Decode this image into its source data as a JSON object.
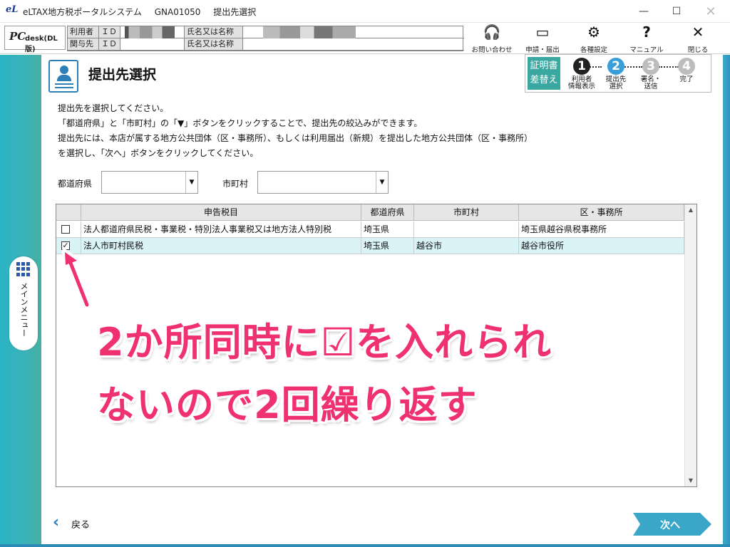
{
  "window": {
    "app_logo": "eL",
    "app_name": "eLTAX地方税ポータルシステム",
    "screen_id": "GNA01050",
    "screen_title": "提出先選択",
    "minimize_glyph": "—",
    "maximize_glyph": "☐",
    "close_glyph": "✕"
  },
  "header": {
    "brand_pc": "PC",
    "brand_desk": "desk(DL版)",
    "user_label": "利用者",
    "related_label": "関与先",
    "id_label": "ＩＤ",
    "name_label": "氏名又は名称",
    "tools": [
      {
        "label": "お問い合わせ",
        "icon": "headset-icon",
        "glyph": "🎧"
      },
      {
        "label": "申請・届出",
        "icon": "form-window-icon",
        "glyph": "▭"
      },
      {
        "label": "各種設定",
        "icon": "gear-icon",
        "glyph": "⚙"
      },
      {
        "label": "マニュアル",
        "icon": "question-icon",
        "glyph": "?"
      },
      {
        "label": "閉じる",
        "icon": "close-icon",
        "glyph": "✕"
      }
    ]
  },
  "sidebar": {
    "main_menu_label": "メインメニュー",
    "icon": "grid-icon"
  },
  "page": {
    "title": "提出先選択",
    "icon": "user-document-icon"
  },
  "steps": {
    "cert_button": [
      "証明書",
      "差替え"
    ],
    "items": [
      {
        "num": "1",
        "label": [
          "利用者",
          "情報表示"
        ],
        "state": "done"
      },
      {
        "num": "2",
        "label": [
          "提出先",
          "選択"
        ],
        "state": "current"
      },
      {
        "num": "3",
        "label": [
          "署名・",
          "送信"
        ],
        "state": "todo"
      },
      {
        "num": "4",
        "label": [
          "完了",
          ""
        ],
        "state": "todo"
      }
    ]
  },
  "instructions": [
    "提出先を選択してください。",
    "「都道府県」と「市町村」の「▼」ボタンをクリックすることで、提出先の絞込みができます。",
    "提出先には、本店が属する地方公共団体（区・事務所）、もしくは利用届出（新規）を提出した地方公共団体（区・事務所）",
    "を選択し、「次へ」ボタンをクリックしてください。"
  ],
  "filters": {
    "prefecture_label": "都道府県",
    "prefecture_value": "",
    "city_label": "市町村",
    "city_value": ""
  },
  "table": {
    "columns": [
      "",
      "申告税目",
      "都道府県",
      "市町村",
      "区・事務所"
    ],
    "rows": [
      {
        "checked": false,
        "tax": "法人都道府県民税・事業税・特別法人事業税又は地方法人特別税",
        "prefecture": "埼玉県",
        "city": "",
        "office": "埼玉県越谷県税事務所"
      },
      {
        "checked": true,
        "tax": "法人市町村民税",
        "prefecture": "埼玉県",
        "city": "越谷市",
        "office": "越谷市役所"
      }
    ]
  },
  "annotation": {
    "line1": "2か所同時に☑を入れられ",
    "line2": "ないので2回繰り返す",
    "color": "#f0316f"
  },
  "footer": {
    "back_label": "戻る",
    "next_label": "次へ"
  },
  "colors": {
    "teal": "#3aa7a0",
    "blue": "#2d7fb8",
    "selected_row": "#d9f3f6",
    "step_done": "#222222",
    "step_current": "#3a9ed8",
    "step_todo": "#bdbdbd"
  }
}
